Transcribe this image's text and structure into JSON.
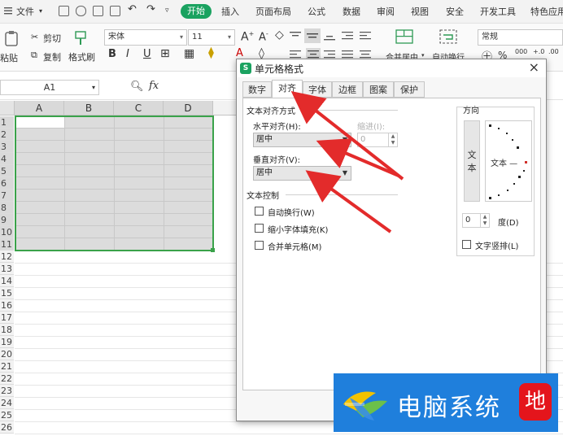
{
  "menubar": {
    "file": "文件",
    "tabs": [
      "开始",
      "插入",
      "页面布局",
      "公式",
      "数据",
      "审阅",
      "视图",
      "安全",
      "开发工具",
      "特色应用"
    ]
  },
  "ribbon": {
    "paste": "粘贴",
    "cut": "剪切",
    "copy": "复制",
    "format_painter": "格式刷",
    "font_name": "宋体",
    "font_size": "11",
    "number_format": "常规",
    "merge_center": "合并居中",
    "auto_wrap": "自动换行",
    "percent": "%",
    "thousands": "000"
  },
  "formula_bar": {
    "cell_ref": "A1",
    "fx": "fx"
  },
  "sheet": {
    "columns": [
      "A",
      "B",
      "C",
      "D"
    ],
    "rows": [
      "1",
      "2",
      "3",
      "4",
      "5",
      "6",
      "7",
      "8",
      "9",
      "10",
      "11",
      "12",
      "13",
      "14",
      "15",
      "16",
      "17",
      "18",
      "19",
      "20",
      "21",
      "22",
      "23",
      "24",
      "25",
      "26"
    ]
  },
  "dialog": {
    "title": "单元格格式",
    "close": "×",
    "tabs": [
      "数字",
      "对齐",
      "字体",
      "边框",
      "图案",
      "保护"
    ],
    "active_tab": "对齐",
    "text_align_group": "文本对齐方式",
    "horizontal_label": "水平对齐(H):",
    "horizontal_value": "居中",
    "indent_label": "缩进(I):",
    "indent_value": "0",
    "vertical_label": "垂直对齐(V):",
    "vertical_value": "居中",
    "text_control_group": "文本控制",
    "wrap_text": "自动换行(W)",
    "shrink_to_fit": "缩小字体填充(K)",
    "merge_cells": "合并单元格(M)",
    "orientation_group": "方向",
    "vertical_text": "文本",
    "dial_text": "文本 —",
    "degrees_value": "0",
    "degrees_label": "度(D)",
    "vertical_layout": "文字竖排(L)"
  },
  "watermark": {
    "text": "电脑系统",
    "red_char": "地"
  },
  "colors": {
    "accent_green": "#1aa260",
    "selection_border": "#3aa24a",
    "annotation_red": "#e32b2b",
    "watermark_blue": "#1f7fdc"
  }
}
